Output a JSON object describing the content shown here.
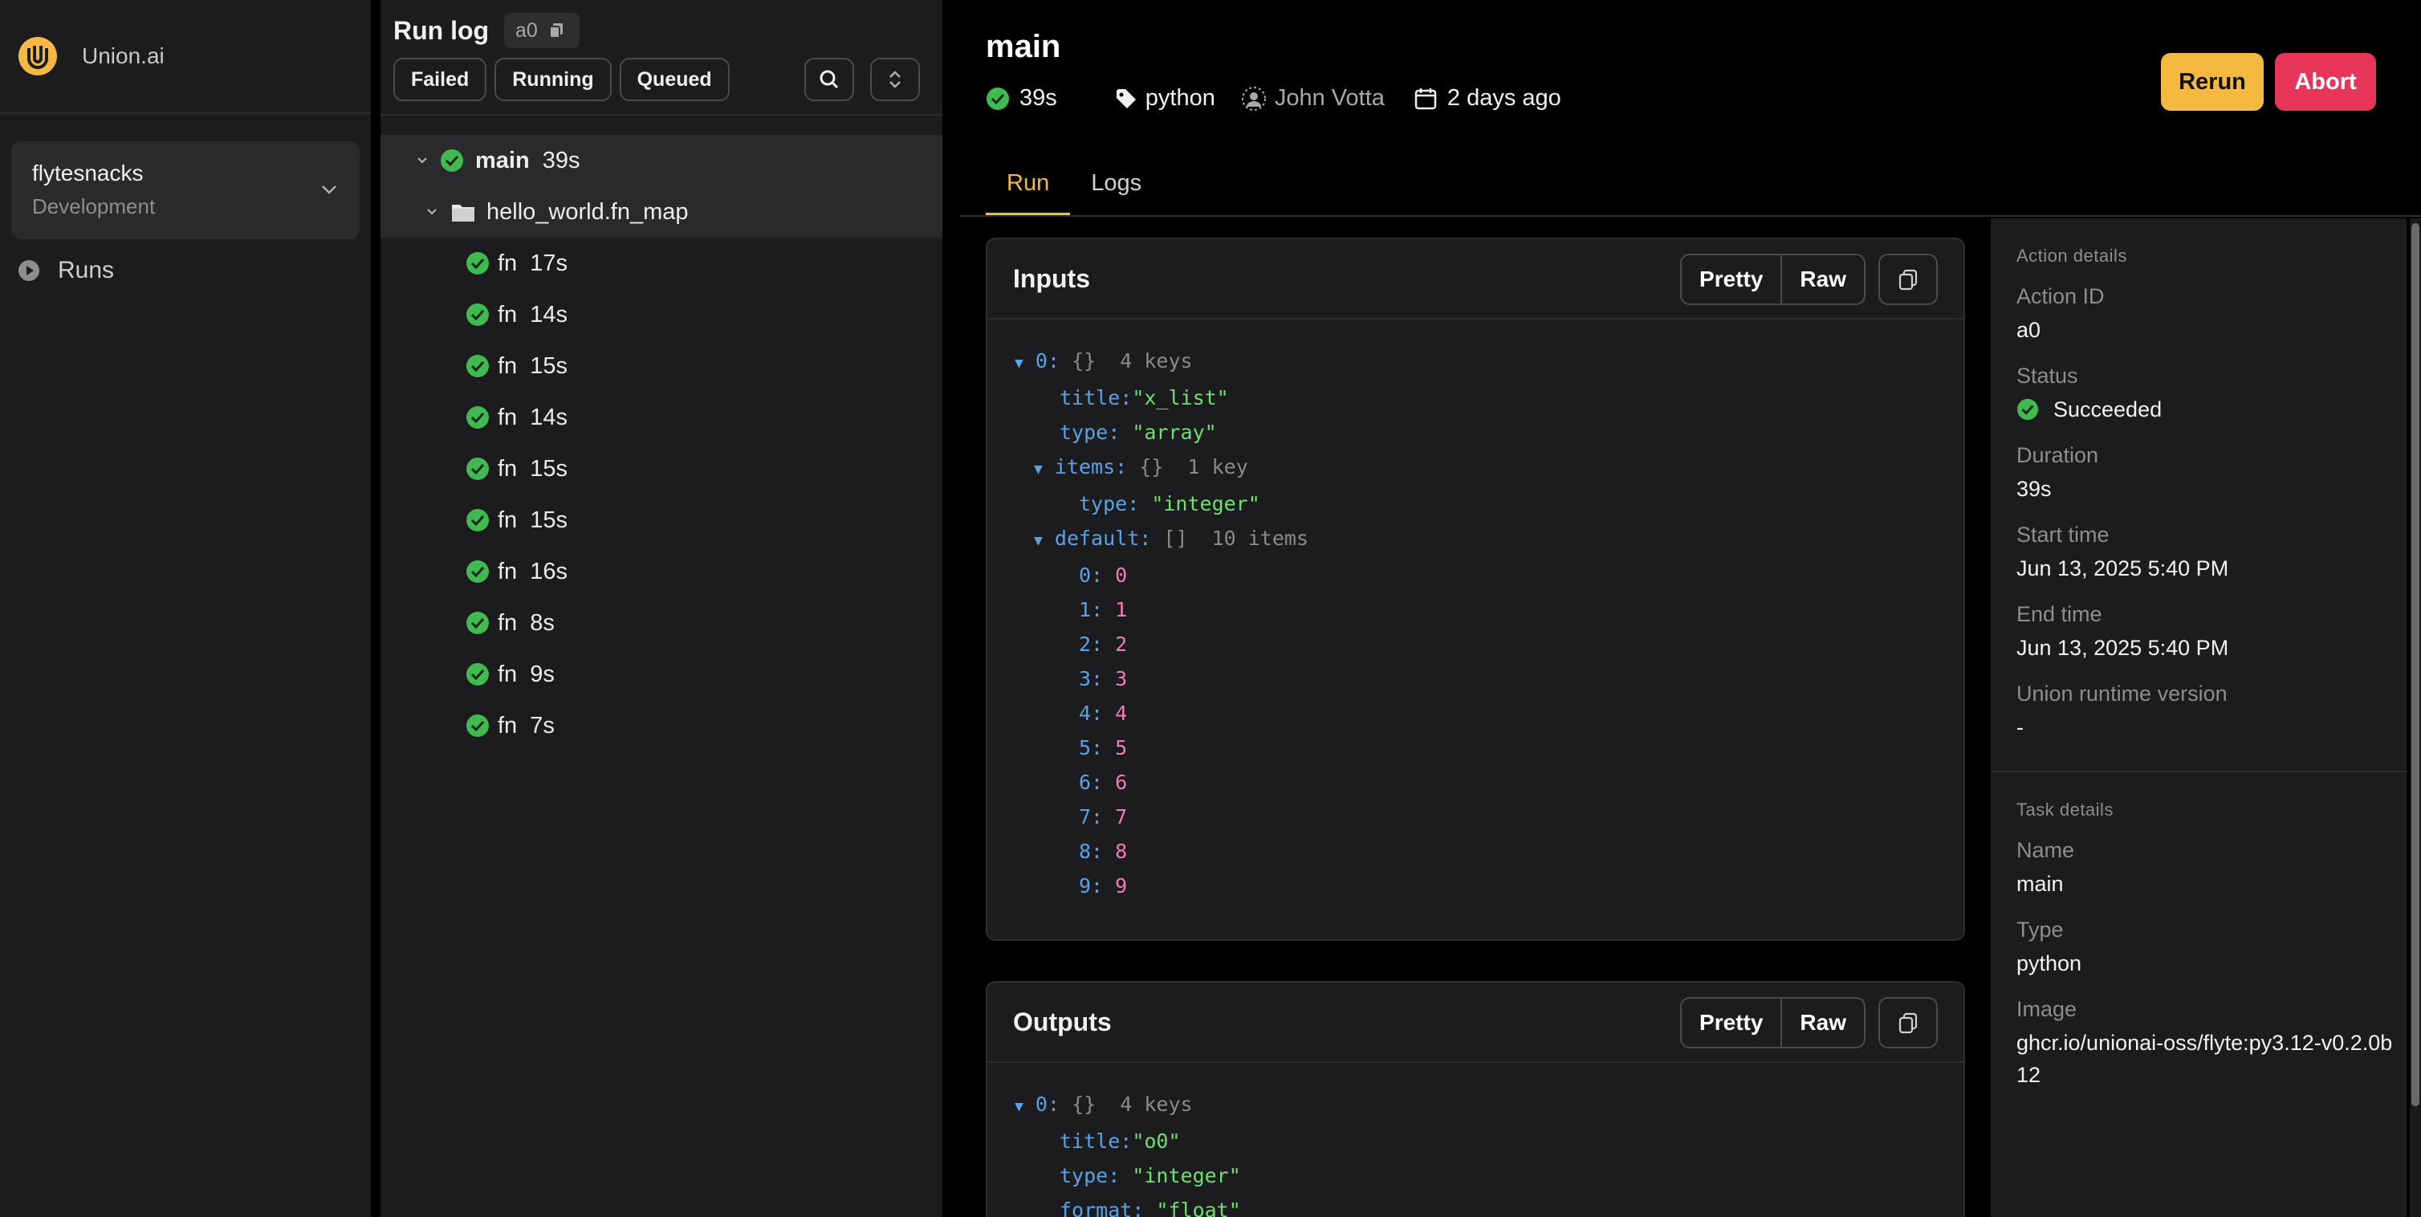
{
  "brand": {
    "name": "Union.ai",
    "accent": "#f5b942"
  },
  "project": {
    "name": "flytesnacks",
    "env": "Development"
  },
  "nav": {
    "runs": "Runs"
  },
  "runlog": {
    "title": "Run log",
    "id": "a0",
    "filters": [
      "Failed",
      "Running",
      "Queued"
    ],
    "tree": [
      {
        "name": "main",
        "duration": "39s",
        "status": "succeeded"
      },
      {
        "name": "hello_world.fn_map"
      },
      {
        "name": "fn",
        "duration": "17s",
        "status": "succeeded"
      },
      {
        "name": "fn",
        "duration": "14s",
        "status": "succeeded"
      },
      {
        "name": "fn",
        "duration": "15s",
        "status": "succeeded"
      },
      {
        "name": "fn",
        "duration": "14s",
        "status": "succeeded"
      },
      {
        "name": "fn",
        "duration": "15s",
        "status": "succeeded"
      },
      {
        "name": "fn",
        "duration": "15s",
        "status": "succeeded"
      },
      {
        "name": "fn",
        "duration": "16s",
        "status": "succeeded"
      },
      {
        "name": "fn",
        "duration": "8s",
        "status": "succeeded"
      },
      {
        "name": "fn",
        "duration": "9s",
        "status": "succeeded"
      },
      {
        "name": "fn",
        "duration": "7s",
        "status": "succeeded"
      }
    ]
  },
  "main": {
    "title": "main",
    "duration": "39s",
    "tag": "python",
    "user": "John Votta",
    "when": "2 days ago",
    "rerun": "Rerun",
    "abort": "Abort",
    "tabs": [
      "Run",
      "Logs"
    ],
    "active_tab": "Run"
  },
  "inputs": {
    "title": "Inputs",
    "pretty": "Pretty",
    "raw": "Raw",
    "root_key": "0:",
    "root_meta": "{}  4 keys",
    "title_key": "title:",
    "title_val": "\"x_list\"",
    "type_key": "type:",
    "type_val": "\"array\"",
    "items_key": "items:",
    "items_meta": "{}  1 key",
    "items_type_key": "type:",
    "items_type_val": "\"integer\"",
    "default_key": "default:",
    "default_meta": "[]  10 items",
    "default_items": [
      "0",
      "1",
      "2",
      "3",
      "4",
      "5",
      "6",
      "7",
      "8",
      "9"
    ]
  },
  "outputs": {
    "title": "Outputs",
    "pretty": "Pretty",
    "raw": "Raw",
    "root_key": "0:",
    "root_meta": "{}  4 keys",
    "title_key": "title:",
    "title_val": "\"o0\"",
    "type_key": "type:",
    "type_val": "\"integer\"",
    "format_key": "format:",
    "format_val": "\"float\""
  },
  "details": {
    "action_title": "Action details",
    "action_id_label": "Action ID",
    "action_id": "a0",
    "status_label": "Status",
    "status": "Succeeded",
    "duration_label": "Duration",
    "duration": "39s",
    "start_label": "Start time",
    "start": "Jun 13, 2025 5:40 PM",
    "end_label": "End time",
    "end": "Jun 13, 2025 5:40 PM",
    "runtime_label": "Union runtime version",
    "runtime": "-",
    "task_title": "Task details",
    "name_label": "Name",
    "name": "main",
    "type_label": "Type",
    "type": "python",
    "image_label": "Image",
    "image": "ghcr.io/unionai-oss/flyte:py3.12-v0.2.0b12"
  },
  "colors": {
    "success": "#3fb950",
    "abort": "#e8365a",
    "rerun": "#f5b942"
  }
}
